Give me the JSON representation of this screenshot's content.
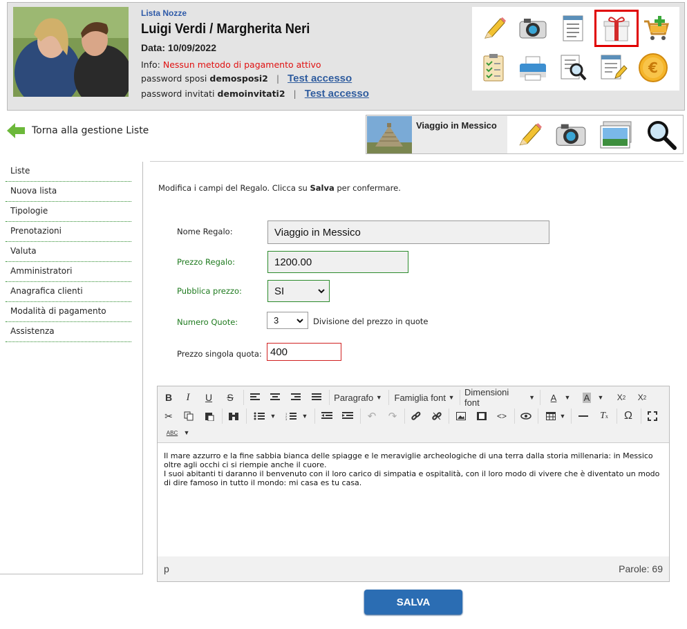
{
  "header": {
    "section": "Lista Nozze",
    "couple": "Luigi Verdi / Margherita Neri",
    "date_label": "Data:",
    "date": "10/09/2022",
    "info_label": "Info:",
    "info_value": "Nessun metodo di pagamento attivo",
    "pw_sposi_label": "password sposi",
    "pw_sposi": "demosposi2",
    "pw_invitati_label": "password invitati",
    "pw_invitati": "demoinvitati2",
    "sep": "|",
    "test_link": "Test accesso"
  },
  "header_icons": [
    "pencil-icon",
    "camera-icon",
    "document-icon",
    "gift-icon",
    "cart-add-icon",
    "checklist-icon",
    "printer-icon",
    "document-search-icon",
    "document-edit-icon",
    "euro-icon"
  ],
  "back": {
    "label": "Torna alla gestione Liste"
  },
  "gift": {
    "name": "Viaggio in Messico"
  },
  "sidebar": {
    "items": [
      {
        "label": "Liste"
      },
      {
        "label": "Nuova lista"
      },
      {
        "label": "Tipologie"
      },
      {
        "label": "Prenotazioni"
      },
      {
        "label": "Valuta"
      },
      {
        "label": "Amministratori"
      },
      {
        "label": "Anagrafica clienti"
      },
      {
        "label": "Modalità di pagamento"
      },
      {
        "label": "Assistenza"
      }
    ]
  },
  "form": {
    "intro_a": "Modifica i campi del Regalo. Clicca su ",
    "intro_b": "Salva",
    "intro_c": " per confermare.",
    "nome_label": "Nome Regalo:",
    "nome_value": "Viaggio in Messico",
    "prezzo_label": "Prezzo Regalo:",
    "prezzo_value": "1200.00",
    "pubblica_label": "Pubblica prezzo:",
    "pubblica_value": "SI",
    "quote_label": "Numero Quote:",
    "quote_value": "3",
    "quote_hint": "Divisione del prezzo in quote",
    "singola_label": "Prezzo singola quota:",
    "singola_value": "400"
  },
  "editor": {
    "paragrafo": "Paragrafo",
    "famiglia": "Famiglia font",
    "dimensioni": "Dimensioni font",
    "text1": "Il mare azzurro e la fine sabbia bianca delle spiagge e le meraviglie archeologiche di una terra dalla storia millenaria: in Messico oltre agli occhi ci si riempie anche il cuore.",
    "text2": "I suoi abitanti ti daranno il benvenuto con il loro carico di simpatia e ospitalità, con il loro modo di vivere che è diventato un modo di dire famoso in tutto il mondo: mi casa es tu casa.",
    "status_tag": "p",
    "word_count": "Parole: 69"
  },
  "save_label": "SALVA",
  "colors": {
    "accent_blue": "#2b6db3",
    "link_blue": "#2f5c9e",
    "error_red": "#e01010",
    "valid_green": "#2a8a2a"
  }
}
